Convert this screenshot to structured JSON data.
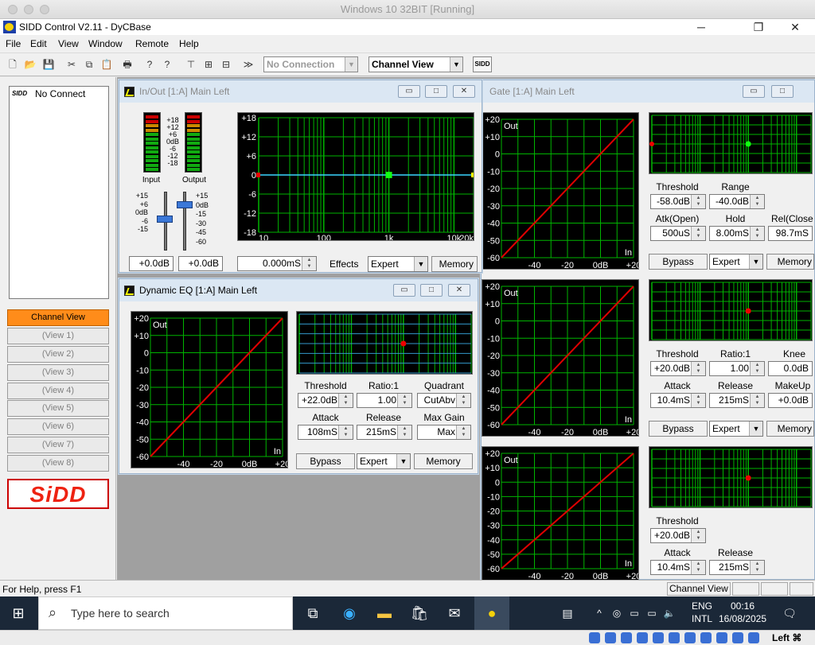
{
  "host": {
    "title": "Windows 10 32BIT [Running]",
    "keyboard": "Left ⌘"
  },
  "app": {
    "title": "SIDD Control V2.11 - DyCBase"
  },
  "menu": [
    "File",
    "Edit",
    "View",
    "Window",
    "Remote",
    "Help"
  ],
  "toolbar": {
    "connection": "No Connection",
    "view": "Channel View",
    "sidd_label": "SIDD"
  },
  "left": {
    "connection_status": "No Connect",
    "sidd_small": "SIDD",
    "views": [
      "Channel View",
      "(View 1)",
      "(View 2)",
      "(View 3)",
      "(View 4)",
      "(View 5)",
      "(View 6)",
      "(View 7)",
      "(View 8)"
    ],
    "logo": "SiDD"
  },
  "colors": {
    "active_view": "#ff8c1a",
    "graph_grid": "#00b400",
    "curve": "#e00000",
    "eq_line": "#3ad6ff"
  },
  "inout": {
    "title": "In/Out [1:A] Main Left",
    "meter_scale": [
      "+18",
      "+12",
      "+6",
      "0dB",
      "-6",
      "-12",
      "-18"
    ],
    "input_label": "Input",
    "output_label": "Output",
    "fader_left": [
      "+15",
      "+6",
      "0dB",
      "-6",
      "-15"
    ],
    "fader_right": [
      "+15",
      "0dB",
      "-15",
      "-30",
      "-45",
      "-60"
    ],
    "graph_y": [
      "+18",
      "+12",
      "+6",
      "0",
      "-6",
      "-12",
      "-18"
    ],
    "graph_x": [
      "10",
      "100",
      "1k",
      "10k",
      "20k"
    ],
    "in_gain": "+0.0dB",
    "out_gain": "+0.0dB",
    "delay": "0.000mS",
    "effects_label": "Effects",
    "mode": "Expert",
    "memory": "Memory"
  },
  "gate": {
    "title": "Gate [1:A] Main Left",
    "threshold_label": "Threshold",
    "threshold": "-58.0dB",
    "range_label": "Range",
    "range": "-40.0dB",
    "atk_label": "Atk(Open)",
    "atk": "500uS",
    "hold_label": "Hold",
    "hold": "8.00mS",
    "rel_label": "Rel(Close",
    "rel": "98.7mS",
    "bypass": "Bypass",
    "mode": "Expert",
    "memory": "Memory"
  },
  "comp": {
    "threshold_label": "Threshold",
    "threshold": "+20.0dB",
    "ratio_label": "Ratio:1",
    "ratio": "1.00",
    "knee_label": "Knee",
    "knee": "0.0dB",
    "attack_label": "Attack",
    "attack": "10.4mS",
    "release_label": "Release",
    "release": "215mS",
    "makeup_label": "MakeUp",
    "makeup": "+0.0dB",
    "bypass": "Bypass",
    "mode": "Expert",
    "memory": "Memory"
  },
  "limiter": {
    "threshold_label": "Threshold",
    "threshold": "+20.0dB",
    "attack_label": "Attack",
    "attack": "10.4mS",
    "release_label": "Release",
    "release": "215mS"
  },
  "deq": {
    "title": "Dynamic EQ [1:A] Main Left",
    "threshold_label": "Threshold",
    "threshold": "+22.0dB",
    "ratio_label": "Ratio:1",
    "ratio": "1.00",
    "quadrant_label": "Quadrant",
    "quadrant": "CutAbv",
    "attack_label": "Attack",
    "attack": "108mS",
    "release_label": "Release",
    "release": "215mS",
    "maxgain_label": "Max Gain",
    "maxgain": "Max",
    "bypass": "Bypass",
    "mode": "Expert",
    "memory": "Memory"
  },
  "transfer_graph": {
    "y": [
      "+20",
      "+10",
      "0",
      "-10",
      "-20",
      "-30",
      "-40",
      "-50",
      "-60"
    ],
    "x": [
      "-40",
      "-20",
      "0dB",
      "+20"
    ],
    "out": "Out",
    "in": "In"
  },
  "status": {
    "help": "For Help, press F1",
    "view": "Channel View"
  },
  "taskbar": {
    "search": "Type here to search",
    "lang1": "ENG",
    "lang2": "INTL",
    "time": "00:16",
    "date": "16/08/2025"
  }
}
